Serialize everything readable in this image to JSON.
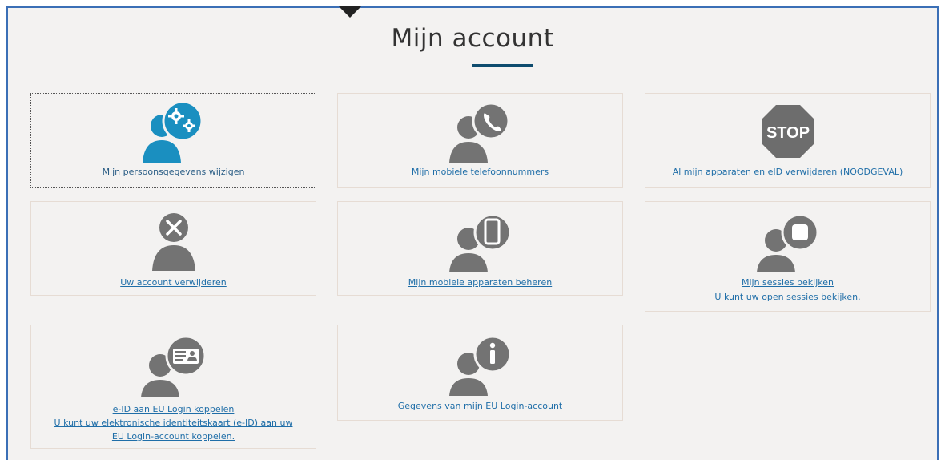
{
  "page": {
    "title": "Mijn account"
  },
  "tiles": {
    "personal": {
      "label": "Mijn persoonsgegevens wijzigen",
      "icon": "person-gears-icon"
    },
    "phones": {
      "label": "Mijn mobiele telefoonnummers",
      "icon": "person-phone-icon"
    },
    "stop": {
      "label": "Al mijn apparaten en eID verwijderen (NOODGEVAL)",
      "icon": "stop-sign-icon",
      "icon_text": "STOP"
    },
    "delete_account": {
      "label": "Uw account verwijderen",
      "icon": "person-x-icon"
    },
    "devices": {
      "label": "Mijn mobiele apparaten beheren",
      "icon": "person-smartphone-icon"
    },
    "sessions": {
      "label": "Mijn sessies bekijken",
      "sublabel": "U kunt uw open sessies bekijken.",
      "icon": "person-session-icon"
    },
    "eid": {
      "label": "e-ID aan EU Login koppelen",
      "sublabel1": "U kunt uw elektronische identiteitskaart (e-ID) aan uw",
      "sublabel2": "EU Login-account koppelen.",
      "icon": "person-id-card-icon"
    },
    "info": {
      "label": "Gegevens van mijn EU Login-account",
      "icon": "person-info-icon"
    }
  },
  "colors": {
    "accent": "#1a8fc0",
    "icon_gray": "#737373",
    "stop_red": "#6d6d6d",
    "link": "#1f6ea8",
    "title_rule": "#0e4c6e"
  }
}
